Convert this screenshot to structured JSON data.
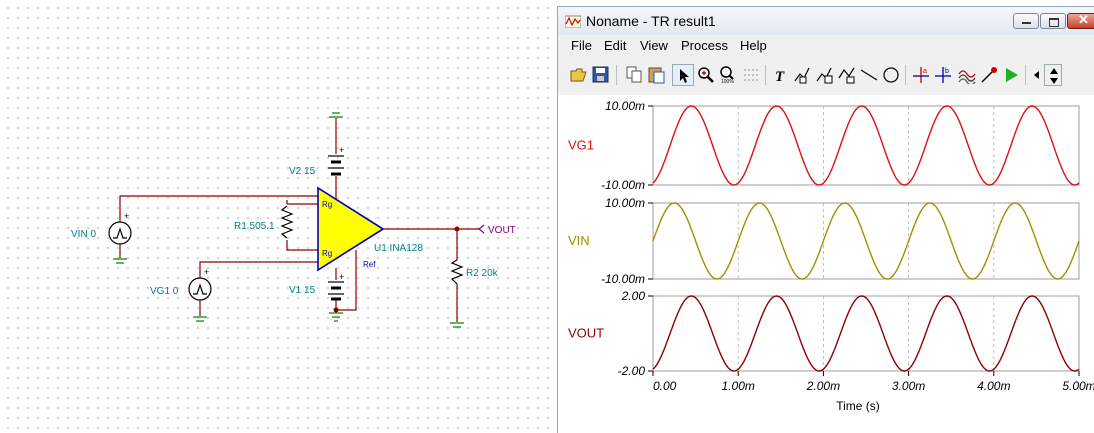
{
  "schematic": {
    "components": {
      "vin": "VIN 0",
      "vg1": "VG1 0",
      "r1": "R1 505.1",
      "v2": "V2 15",
      "v1": "V1 15",
      "u1": "U1 INA128",
      "r2": "R2 20k",
      "vout": "VOUT"
    },
    "pins": {
      "rg_top": "Rg",
      "rg_bottom": "Rg",
      "ref": "Ref",
      "plus": "+",
      "minus": "-"
    },
    "colors": {
      "wire": "#8b0000",
      "label": "#008080",
      "opamp_fill": "#ffff00",
      "opamp_stroke": "#0000c0",
      "vout": "#800080"
    }
  },
  "window": {
    "title": "Noname - TR result1",
    "menu": [
      "File",
      "Edit",
      "View",
      "Process",
      "Help"
    ],
    "toolbar_icons": [
      "open-icon",
      "save-icon",
      "copy-icon",
      "paste-icon",
      "pointer-icon",
      "zoom-in-icon",
      "zoom-100-icon",
      "grid-icon",
      "text-icon",
      "annotate-icon",
      "annotate-2-icon",
      "annotate-3-icon",
      "line-icon",
      "circle-icon",
      "cursor-a-icon",
      "cursor-b-icon",
      "curve-icon",
      "probe-icon",
      "run-icon",
      "nav-left-icon",
      "nav-spin-icon"
    ]
  },
  "chart_data": [
    {
      "type": "line",
      "series": [
        {
          "name": "VG1",
          "color": "#e01010"
        }
      ],
      "ylim": [
        -10,
        10
      ],
      "tick_labels": [
        "10.00m",
        "-10.00m"
      ],
      "amplitude": 0.01,
      "frequency_hz": 1000,
      "phase_cycles": -0.2,
      "shape": "sine"
    },
    {
      "type": "line",
      "series": [
        {
          "name": "VIN",
          "color": "#a09000"
        }
      ],
      "ylim": [
        -10,
        10
      ],
      "tick_labels": [
        "10.00m",
        "-10.00m"
      ],
      "amplitude": 0.01,
      "frequency_hz": 1000,
      "phase_cycles": 0.0,
      "shape": "sine"
    },
    {
      "type": "line",
      "series": [
        {
          "name": "VOUT",
          "color": "#900000"
        }
      ],
      "ylim": [
        -2,
        2
      ],
      "tick_labels": [
        "2.00",
        "-2.00"
      ],
      "amplitude": 2.0,
      "frequency_hz": 1000,
      "phase_cycles": -0.2,
      "shape": "sine"
    }
  ],
  "x_axis": {
    "label": "Time (s)",
    "tick_labels": [
      "0.00",
      "1.00m",
      "2.00m",
      "3.00m",
      "4.00m",
      "5.00m"
    ],
    "xlim": [
      0,
      0.005
    ]
  }
}
